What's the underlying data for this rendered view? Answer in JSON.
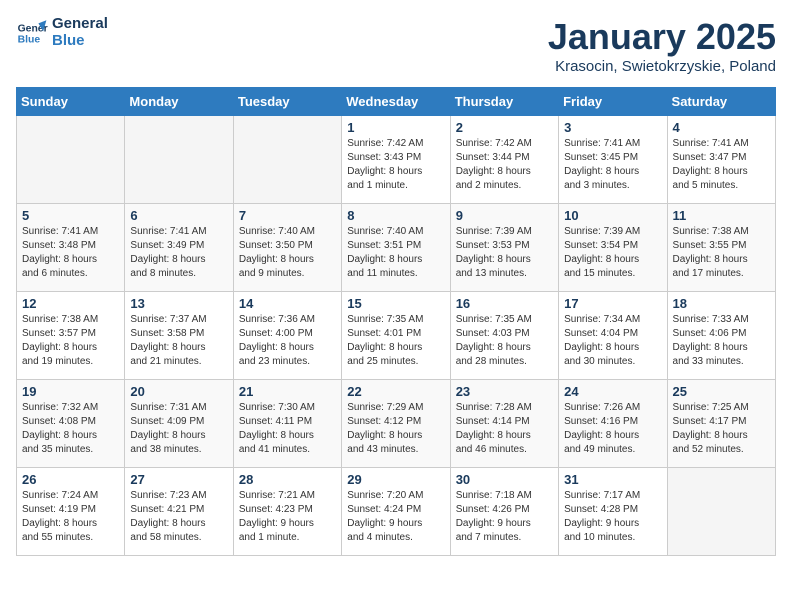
{
  "header": {
    "logo_line1": "General",
    "logo_line2": "Blue",
    "month_title": "January 2025",
    "location": "Krasocin, Swietokrzyskie, Poland"
  },
  "weekdays": [
    "Sunday",
    "Monday",
    "Tuesday",
    "Wednesday",
    "Thursday",
    "Friday",
    "Saturday"
  ],
  "weeks": [
    [
      {
        "day": "",
        "info": ""
      },
      {
        "day": "",
        "info": ""
      },
      {
        "day": "",
        "info": ""
      },
      {
        "day": "1",
        "info": "Sunrise: 7:42 AM\nSunset: 3:43 PM\nDaylight: 8 hours\nand 1 minute."
      },
      {
        "day": "2",
        "info": "Sunrise: 7:42 AM\nSunset: 3:44 PM\nDaylight: 8 hours\nand 2 minutes."
      },
      {
        "day": "3",
        "info": "Sunrise: 7:41 AM\nSunset: 3:45 PM\nDaylight: 8 hours\nand 3 minutes."
      },
      {
        "day": "4",
        "info": "Sunrise: 7:41 AM\nSunset: 3:47 PM\nDaylight: 8 hours\nand 5 minutes."
      }
    ],
    [
      {
        "day": "5",
        "info": "Sunrise: 7:41 AM\nSunset: 3:48 PM\nDaylight: 8 hours\nand 6 minutes."
      },
      {
        "day": "6",
        "info": "Sunrise: 7:41 AM\nSunset: 3:49 PM\nDaylight: 8 hours\nand 8 minutes."
      },
      {
        "day": "7",
        "info": "Sunrise: 7:40 AM\nSunset: 3:50 PM\nDaylight: 8 hours\nand 9 minutes."
      },
      {
        "day": "8",
        "info": "Sunrise: 7:40 AM\nSunset: 3:51 PM\nDaylight: 8 hours\nand 11 minutes."
      },
      {
        "day": "9",
        "info": "Sunrise: 7:39 AM\nSunset: 3:53 PM\nDaylight: 8 hours\nand 13 minutes."
      },
      {
        "day": "10",
        "info": "Sunrise: 7:39 AM\nSunset: 3:54 PM\nDaylight: 8 hours\nand 15 minutes."
      },
      {
        "day": "11",
        "info": "Sunrise: 7:38 AM\nSunset: 3:55 PM\nDaylight: 8 hours\nand 17 minutes."
      }
    ],
    [
      {
        "day": "12",
        "info": "Sunrise: 7:38 AM\nSunset: 3:57 PM\nDaylight: 8 hours\nand 19 minutes."
      },
      {
        "day": "13",
        "info": "Sunrise: 7:37 AM\nSunset: 3:58 PM\nDaylight: 8 hours\nand 21 minutes."
      },
      {
        "day": "14",
        "info": "Sunrise: 7:36 AM\nSunset: 4:00 PM\nDaylight: 8 hours\nand 23 minutes."
      },
      {
        "day": "15",
        "info": "Sunrise: 7:35 AM\nSunset: 4:01 PM\nDaylight: 8 hours\nand 25 minutes."
      },
      {
        "day": "16",
        "info": "Sunrise: 7:35 AM\nSunset: 4:03 PM\nDaylight: 8 hours\nand 28 minutes."
      },
      {
        "day": "17",
        "info": "Sunrise: 7:34 AM\nSunset: 4:04 PM\nDaylight: 8 hours\nand 30 minutes."
      },
      {
        "day": "18",
        "info": "Sunrise: 7:33 AM\nSunset: 4:06 PM\nDaylight: 8 hours\nand 33 minutes."
      }
    ],
    [
      {
        "day": "19",
        "info": "Sunrise: 7:32 AM\nSunset: 4:08 PM\nDaylight: 8 hours\nand 35 minutes."
      },
      {
        "day": "20",
        "info": "Sunrise: 7:31 AM\nSunset: 4:09 PM\nDaylight: 8 hours\nand 38 minutes."
      },
      {
        "day": "21",
        "info": "Sunrise: 7:30 AM\nSunset: 4:11 PM\nDaylight: 8 hours\nand 41 minutes."
      },
      {
        "day": "22",
        "info": "Sunrise: 7:29 AM\nSunset: 4:12 PM\nDaylight: 8 hours\nand 43 minutes."
      },
      {
        "day": "23",
        "info": "Sunrise: 7:28 AM\nSunset: 4:14 PM\nDaylight: 8 hours\nand 46 minutes."
      },
      {
        "day": "24",
        "info": "Sunrise: 7:26 AM\nSunset: 4:16 PM\nDaylight: 8 hours\nand 49 minutes."
      },
      {
        "day": "25",
        "info": "Sunrise: 7:25 AM\nSunset: 4:17 PM\nDaylight: 8 hours\nand 52 minutes."
      }
    ],
    [
      {
        "day": "26",
        "info": "Sunrise: 7:24 AM\nSunset: 4:19 PM\nDaylight: 8 hours\nand 55 minutes."
      },
      {
        "day": "27",
        "info": "Sunrise: 7:23 AM\nSunset: 4:21 PM\nDaylight: 8 hours\nand 58 minutes."
      },
      {
        "day": "28",
        "info": "Sunrise: 7:21 AM\nSunset: 4:23 PM\nDaylight: 9 hours\nand 1 minute."
      },
      {
        "day": "29",
        "info": "Sunrise: 7:20 AM\nSunset: 4:24 PM\nDaylight: 9 hours\nand 4 minutes."
      },
      {
        "day": "30",
        "info": "Sunrise: 7:18 AM\nSunset: 4:26 PM\nDaylight: 9 hours\nand 7 minutes."
      },
      {
        "day": "31",
        "info": "Sunrise: 7:17 AM\nSunset: 4:28 PM\nDaylight: 9 hours\nand 10 minutes."
      },
      {
        "day": "",
        "info": ""
      }
    ]
  ]
}
